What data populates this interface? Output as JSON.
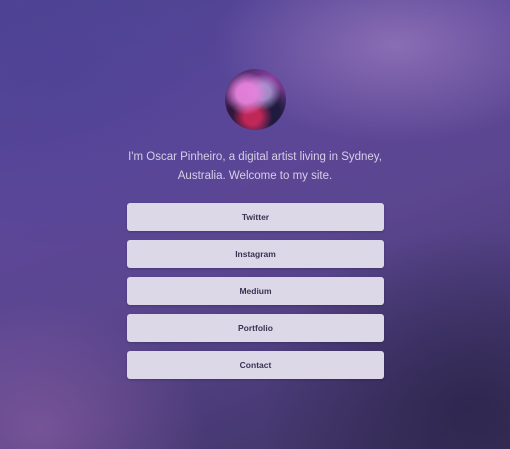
{
  "profile": {
    "avatar_alt": "Oscar Pinheiro",
    "bio": "I'm Oscar Pinheiro, a digital artist living in Sydney, Australia. Welcome to my site."
  },
  "links": [
    {
      "label": "Twitter"
    },
    {
      "label": "Instagram"
    },
    {
      "label": "Medium"
    },
    {
      "label": "Portfolio"
    },
    {
      "label": "Contact"
    }
  ],
  "colors": {
    "background": "#4b3c84",
    "button": "#dcd8e8",
    "button_text": "#3a3252",
    "bio_text": "#d6cfe6"
  }
}
